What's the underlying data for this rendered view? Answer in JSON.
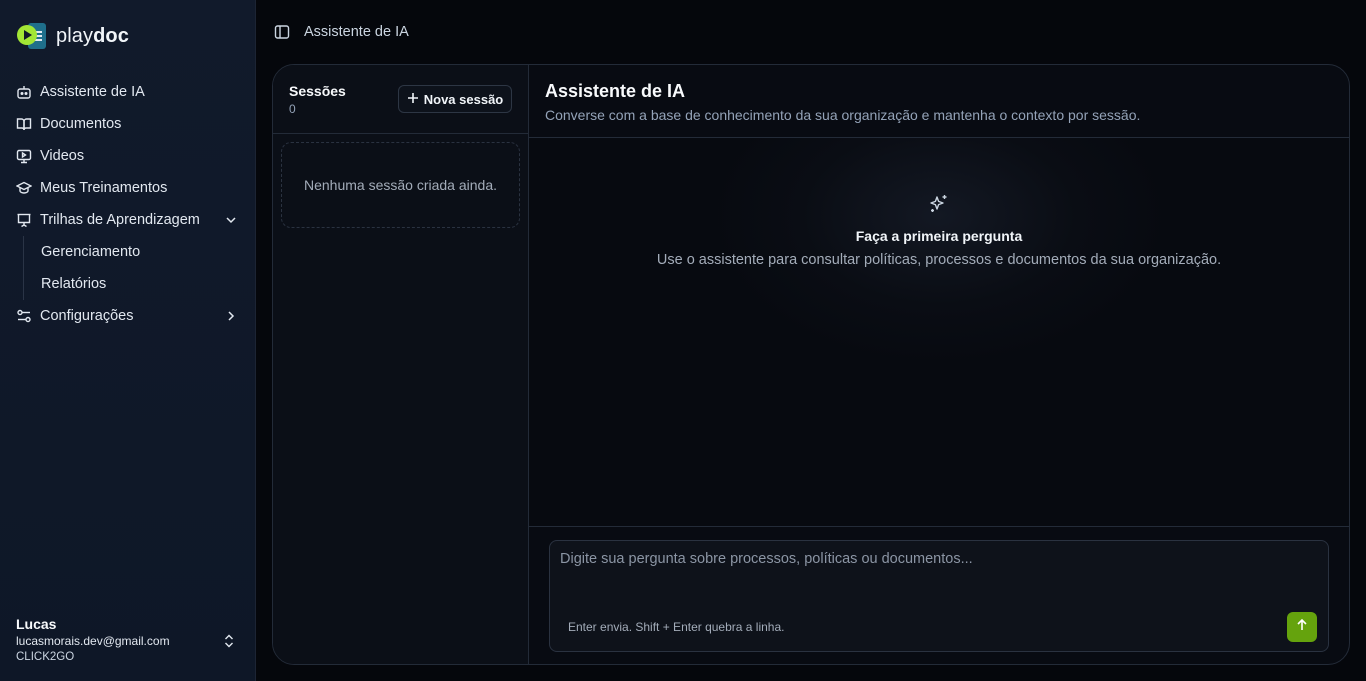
{
  "brand": {
    "name_light": "play",
    "name_bold": "doc"
  },
  "sidebar": {
    "items": [
      {
        "label": "Assistente de IA",
        "icon": "bot-icon"
      },
      {
        "label": "Documentos",
        "icon": "book-icon"
      },
      {
        "label": "Videos",
        "icon": "monitor-play-icon"
      },
      {
        "label": "Meus Treinamentos",
        "icon": "graduation-cap-icon"
      },
      {
        "label": "Trilhas de Aprendizagem",
        "icon": "presentation-icon",
        "expanded": true,
        "children": [
          {
            "label": "Gerenciamento"
          },
          {
            "label": "Relatórios"
          }
        ]
      },
      {
        "label": "Configurações",
        "icon": "settings-sliders-icon",
        "expanded": false
      }
    ],
    "user": {
      "name": "Lucas",
      "email": "lucasmorais.dev@gmail.com",
      "org": "CLICK2GO"
    }
  },
  "header": {
    "breadcrumb": "Assistente de IA"
  },
  "sessions": {
    "title": "Sessões",
    "count": "0",
    "new_button": "Nova sessão",
    "empty_text": "Nenhuma sessão criada ainda."
  },
  "chat": {
    "title": "Assistente de IA",
    "subtitle": "Converse com a base de conhecimento da sua organização e mantenha o contexto por sessão.",
    "empty_title": "Faça a primeira pergunta",
    "empty_subtitle": "Use o assistente para consultar políticas, processos e documentos da sua organização.",
    "input_placeholder": "Digite sua pergunta sobre processos, políticas ou documentos...",
    "input_value": "",
    "hint": "Enter envia. Shift + Enter quebra a linha."
  },
  "colors": {
    "accent": "#65a30d",
    "sidebar_bg": "#0f172a",
    "page_bg": "#05070c"
  }
}
